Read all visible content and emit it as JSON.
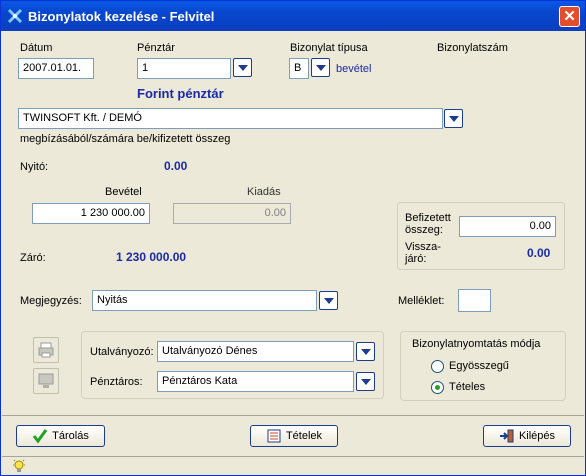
{
  "window": {
    "title": "Bizonylatok kezelése - Felvitel",
    "close_label": "✕"
  },
  "header": {
    "datum_label": "Dátum",
    "datum_value": "2007.01.01.",
    "penztar_label": "Pénztár",
    "penztar_value": "1",
    "penztar_name": "Forint pénztár",
    "bizonylat_tipus_label": "Bizonylat típusa",
    "bizonylat_tipus_value": "B",
    "bizonylat_tipus_text": "bevétel",
    "bizonylatszam_label": "Bizonylatszám"
  },
  "partner": {
    "value": "TWINSOFT Kft. / DEMÓ",
    "caption": "megbízásából/számára  be/kifizetett összeg"
  },
  "amounts": {
    "nyito_label": "Nyitó:",
    "nyito_value": "0.00",
    "bevetel_label": "Bevétel",
    "bevetel_value": "1 230 000.00",
    "kiadas_label": "Kiadás",
    "kiadas_value": "0.00",
    "zaro_label": "Záró:",
    "zaro_value": "1 230 000.00"
  },
  "payment": {
    "befizetett_label": "Befizetett összeg:",
    "befizetett_value": "0.00",
    "visszajaro_label": "Vissza-járó:",
    "visszajaro_value": "0.00"
  },
  "notes": {
    "megjegyzes_label": "Megjegyzés:",
    "megjegyzes_value": "Nyitás",
    "melleklet_label": "Melléklet:",
    "melleklet_value": ""
  },
  "persons": {
    "utalvanyozo_label": "Utalványozó:",
    "utalvanyozo_value": "Utalványozó Dénes",
    "penztaros_label": "Pénztáros:",
    "penztaros_value": "Pénztáros Kata"
  },
  "print_mode": {
    "title": "Bizonylatnyomtatás módja",
    "options": [
      "Egyösszegű",
      "Tételes"
    ],
    "selected": "Tételes"
  },
  "buttons": {
    "save": "Tárolás",
    "items": "Tételek",
    "exit": "Kilépés"
  },
  "colors": {
    "title_bar": "#0846cc",
    "value_blue": "#1a2aa8",
    "background": "#ece9d8"
  }
}
